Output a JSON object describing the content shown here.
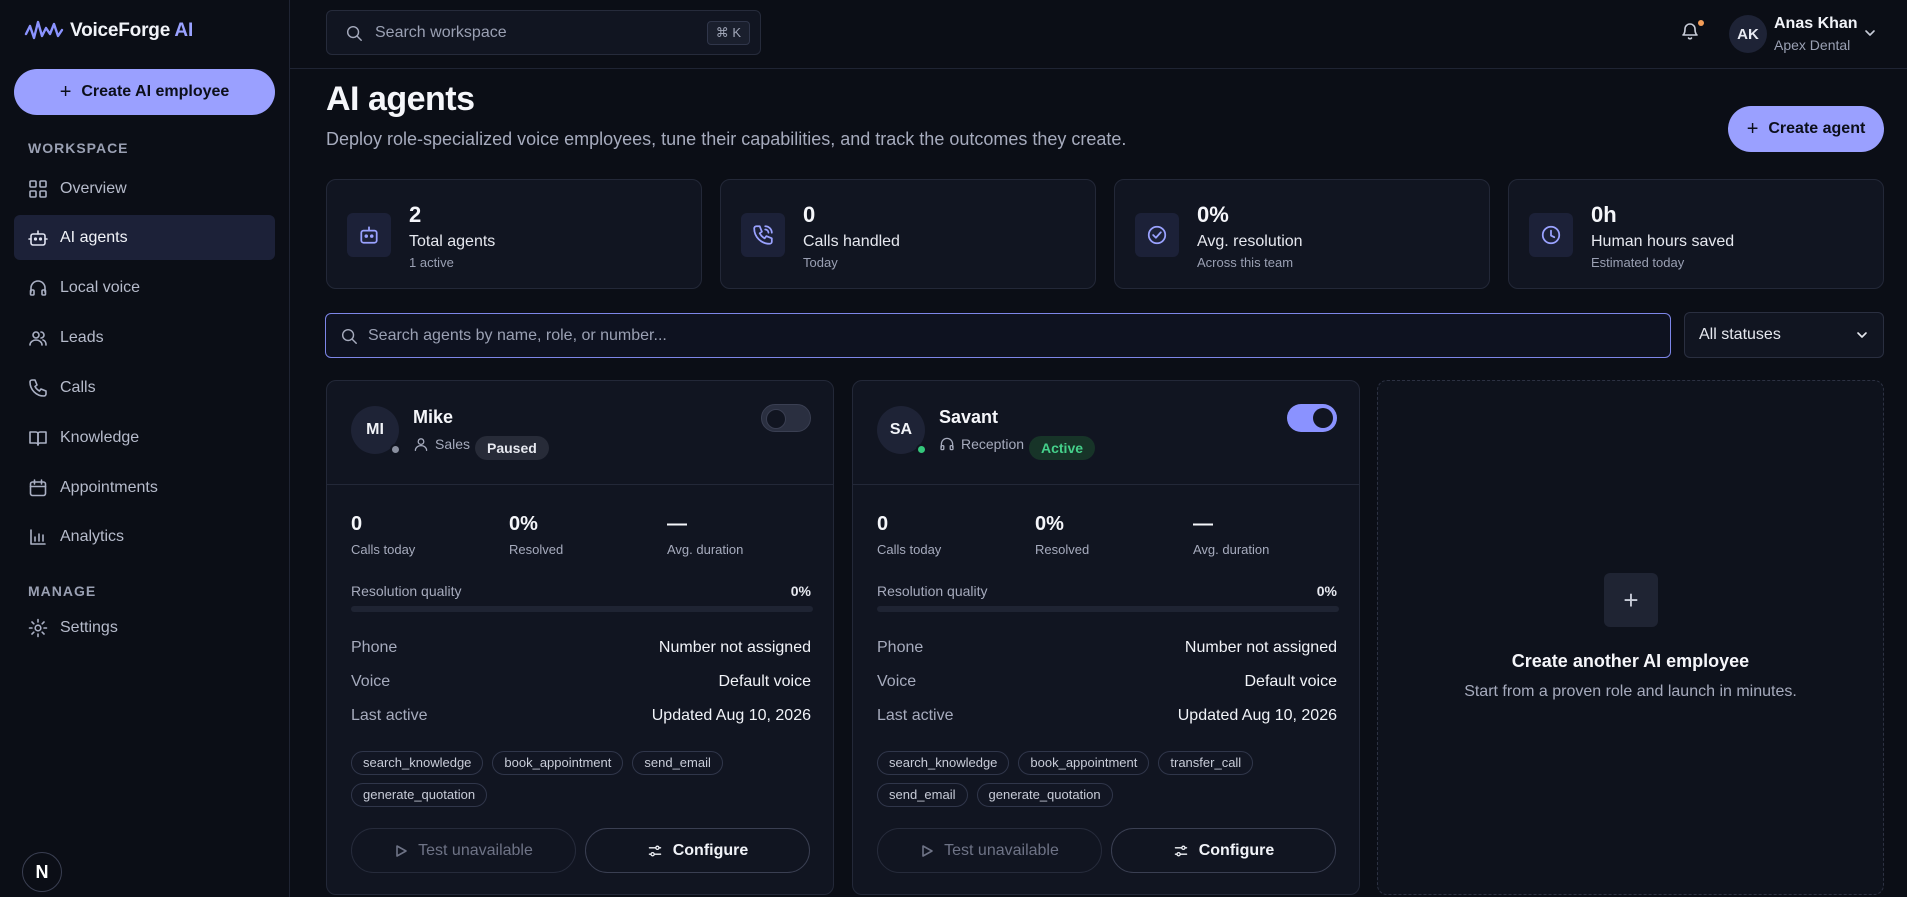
{
  "brand": {
    "name": "VoiceForge",
    "suffix": " AI"
  },
  "sidebar": {
    "create_button": "Create AI employee",
    "workspace_label": "WORKSPACE",
    "manage_label": "MANAGE",
    "items": [
      {
        "label": "Overview",
        "icon": "grid-icon"
      },
      {
        "label": "AI agents",
        "icon": "bot-icon",
        "active": true
      },
      {
        "label": "Local voice",
        "icon": "headphones-icon"
      },
      {
        "label": "Leads",
        "icon": "users-icon"
      },
      {
        "label": "Calls",
        "icon": "phone-icon"
      },
      {
        "label": "Knowledge",
        "icon": "book-icon"
      },
      {
        "label": "Appointments",
        "icon": "calendar-icon"
      },
      {
        "label": "Analytics",
        "icon": "bar-chart-icon"
      }
    ],
    "manage_items": [
      {
        "label": "Settings",
        "icon": "gear-icon"
      }
    ],
    "footer_badge": "N"
  },
  "topbar": {
    "search_placeholder": "Search workspace",
    "shortcut": "⌘ K",
    "user": {
      "initials": "AK",
      "name": "Anas Khan",
      "org": "Apex Dental"
    }
  },
  "header": {
    "title": "AI agents",
    "subtitle": "Deploy role-specialized voice employees, tune their capabilities, and track the outcomes they create.",
    "create_button": "Create agent"
  },
  "stats": [
    {
      "value": "2",
      "label": "Total agents",
      "sub": "1 active",
      "icon": "bot-icon"
    },
    {
      "value": "0",
      "label": "Calls handled",
      "sub": "Today",
      "icon": "phone-call-icon"
    },
    {
      "value": "0%",
      "label": "Avg. resolution",
      "sub": "Across this team",
      "icon": "check-circle-icon"
    },
    {
      "value": "0h",
      "label": "Human hours saved",
      "sub": "Estimated today",
      "icon": "clock-icon"
    }
  ],
  "filters": {
    "search_placeholder": "Search agents by name, role, or number...",
    "status_selected": "All statuses"
  },
  "agents": [
    {
      "initials": "MI",
      "name": "Mike",
      "role": "Sales",
      "status": "Paused",
      "enabled": false,
      "calls_today": "0",
      "calls_today_label": "Calls today",
      "resolved": "0%",
      "resolved_label": "Resolved",
      "avg_duration": "—",
      "avg_duration_label": "Avg. duration",
      "quality_label": "Resolution quality",
      "quality_value": "0%",
      "quality_fraction": 0,
      "phone_label": "Phone",
      "phone": "Number not assigned",
      "voice_label": "Voice",
      "voice": "Default voice",
      "last_active_label": "Last active",
      "last_active": "Updated Aug 10, 2026",
      "tools": [
        "search_knowledge",
        "book_appointment",
        "send_email",
        "generate_quotation"
      ],
      "test_label": "Test unavailable",
      "configure_label": "Configure"
    },
    {
      "initials": "SA",
      "name": "Savant",
      "role": "Reception",
      "status": "Active",
      "enabled": true,
      "calls_today": "0",
      "calls_today_label": "Calls today",
      "resolved": "0%",
      "resolved_label": "Resolved",
      "avg_duration": "—",
      "avg_duration_label": "Avg. duration",
      "quality_label": "Resolution quality",
      "quality_value": "0%",
      "quality_fraction": 0,
      "phone_label": "Phone",
      "phone": "Number not assigned",
      "voice_label": "Voice",
      "voice": "Default voice",
      "last_active_label": "Last active",
      "last_active": "Updated Aug 10, 2026",
      "tools": [
        "search_knowledge",
        "book_appointment",
        "transfer_call",
        "send_email",
        "generate_quotation"
      ],
      "test_label": "Test unavailable",
      "configure_label": "Configure"
    }
  ],
  "create_another": {
    "title": "Create another AI employee",
    "subtitle": "Start from a proven role and launch in minutes."
  },
  "colors": {
    "accent": "#9aa0ff",
    "active_green": "#45d08a",
    "background": "#0b0e16"
  }
}
